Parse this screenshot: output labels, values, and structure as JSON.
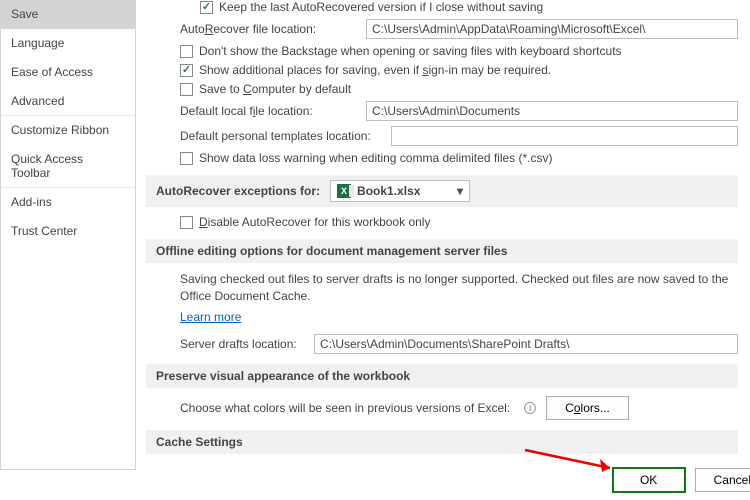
{
  "sidebar": {
    "items": [
      {
        "label": "Save",
        "selected": true
      },
      {
        "label": "Language"
      },
      {
        "label": "Ease of Access"
      },
      {
        "label": "Advanced",
        "sep": true
      },
      {
        "label": "Customize Ribbon"
      },
      {
        "label": "Quick Access Toolbar",
        "sep": true
      },
      {
        "label": "Add-ins"
      },
      {
        "label": "Trust Center"
      }
    ]
  },
  "main": {
    "keepLast": "Keep the last AutoRecovered version if I close without saving",
    "autoRecoverLabel": "AutoRecover file location:",
    "autoRecoverValue": "C:\\Users\\Admin\\AppData\\Roaming\\Microsoft\\Excel\\",
    "dontShowBackstage": "Don't show the Backstage when opening or saving files with keyboard shortcuts",
    "showAdditional": "Show additional places for saving, even if sign-in may be required.",
    "saveToComputer": "Save to Computer by default",
    "defaultLocalLabel": "Default local file location:",
    "defaultLocalValue": "C:\\Users\\Admin\\Documents",
    "defaultTemplatesLabel": "Default personal templates location:",
    "defaultTemplatesValue": "",
    "dataLossWarning": "Show data loss warning when editing comma delimited files (*.csv)",
    "autoRecoverExceptionsHeader": "AutoRecover exceptions for:",
    "workbookName": "Book1.xlsx",
    "disableAutoRecover": "Disable AutoRecover for this workbook only",
    "offlineHeader": "Offline editing options for document management server files",
    "offlineBody": "Saving checked out files to server drafts is no longer supported. Checked out files are now saved to the Office Document Cache.",
    "learnMore": "Learn more",
    "serverDraftsLabel": "Server drafts location:",
    "serverDraftsValue": "C:\\Users\\Admin\\Documents\\SharePoint Drafts\\",
    "preserveHeader": "Preserve visual appearance of the workbook",
    "chooseColors": "Choose what colors will be seen in previous versions of Excel:",
    "colorsBtn": "Colors...",
    "cacheHeader": "Cache Settings"
  },
  "footer": {
    "ok": "OK",
    "cancel": "Cancel"
  }
}
